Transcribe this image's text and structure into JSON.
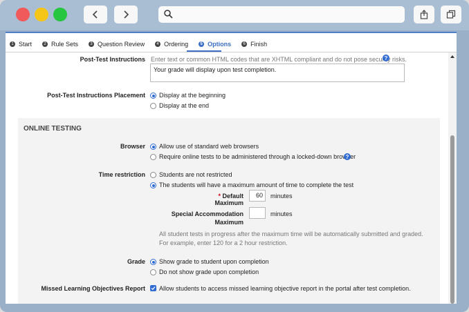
{
  "steps": [
    {
      "num": "1",
      "label": "Start"
    },
    {
      "num": "2",
      "label": "Rule Sets"
    },
    {
      "num": "3",
      "label": "Question Review"
    },
    {
      "num": "4",
      "label": "Ordering"
    },
    {
      "num": "5",
      "label": "Options"
    },
    {
      "num": "6",
      "label": "Finish"
    }
  ],
  "post_test": {
    "label": "Post-Test Instructions",
    "hint": "Enter text or common HTML codes that are XHTML compliant and do not pose security risks.",
    "value": "Your grade will display upon test completion."
  },
  "placement": {
    "label": "Post-Test Instructions Placement",
    "options": [
      "Display at the beginning",
      "Display at the end"
    ]
  },
  "online_testing": {
    "title": "ONLINE TESTING",
    "browser": {
      "label": "Browser",
      "options": [
        "Allow use of standard web browsers",
        "Require online tests to be administered through a locked-down browser"
      ]
    },
    "time_restriction": {
      "label": "Time restriction",
      "options": [
        "Students are not restricted",
        "The students will have a maximum amount of time to complete the test"
      ],
      "required_mark": "*",
      "default_max_label": "Default Maximum",
      "default_max_value": "60",
      "units": "minutes",
      "special_label_1": "Special Accommodation",
      "special_label_2": "Maximum",
      "special_value": "",
      "note_1": "All student tests in progress after the maximum time will be automatically submitted and graded.",
      "note_2": "For example, enter 120 for a 2 hour restriction."
    },
    "grade": {
      "label": "Grade",
      "options": [
        "Show grade to student upon completion",
        "Do not show grade upon completion"
      ]
    },
    "missed": {
      "label": "Missed Learning Objectives Report",
      "text": "Allow students to access missed learning objective report in the portal after test completion."
    }
  },
  "colors": {
    "accent": "#2f6bd1",
    "window": "#9ab0c8"
  }
}
